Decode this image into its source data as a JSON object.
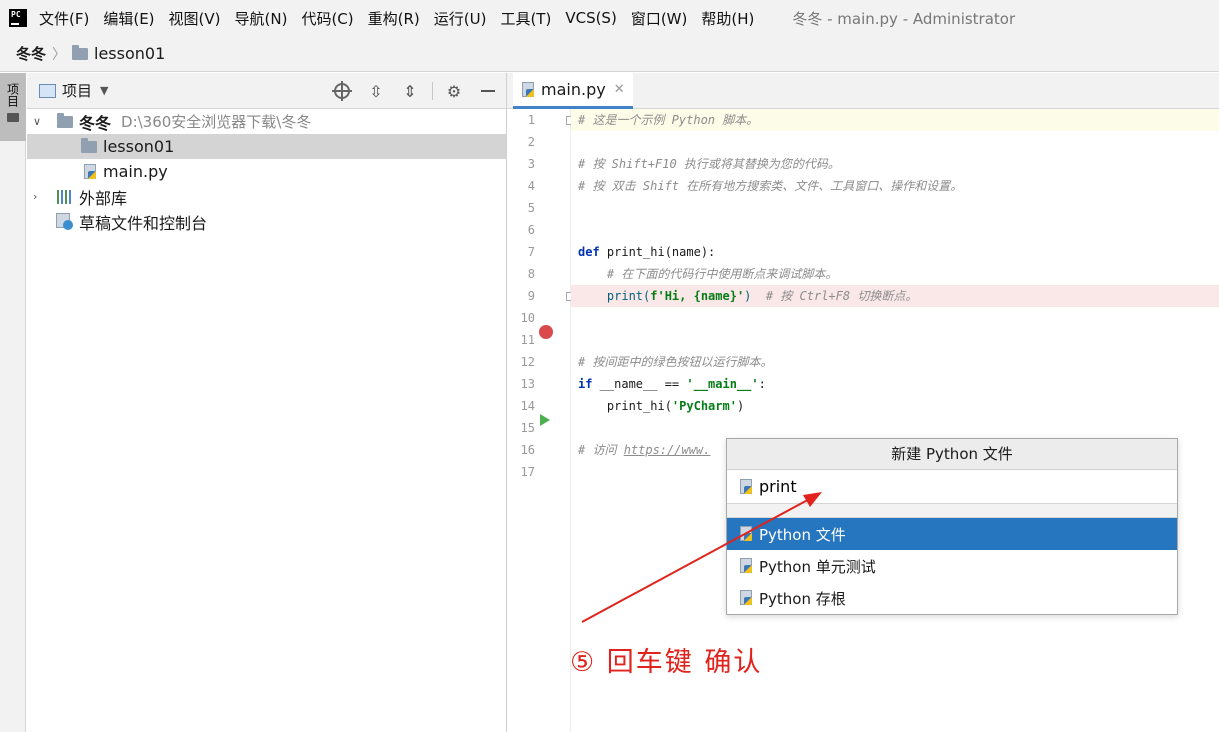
{
  "menubar": {
    "items": [
      "文件(F)",
      "编辑(E)",
      "视图(V)",
      "导航(N)",
      "代码(C)",
      "重构(R)",
      "运行(U)",
      "工具(T)",
      "VCS(S)",
      "窗口(W)",
      "帮助(H)"
    ],
    "window_title": "冬冬 - main.py - Administrator",
    "logo_text": "PC"
  },
  "breadcrumb": {
    "root": "冬冬",
    "child": "lesson01"
  },
  "toolstrip": {
    "project_label": "项目"
  },
  "project_panel": {
    "title": "项目",
    "tree": {
      "root_name": "冬冬",
      "root_path": "D:\\360安全浏览器下载\\冬冬",
      "folder": "lesson01",
      "file": "main.py",
      "external_libs": "外部库",
      "scratches": "草稿文件和控制台"
    }
  },
  "editor": {
    "tab_label": "main.py",
    "line_numbers": [
      "1",
      "2",
      "3",
      "4",
      "5",
      "6",
      "7",
      "8",
      "9",
      "10",
      "11",
      "12",
      "13",
      "14",
      "15",
      "16",
      "17"
    ],
    "code": {
      "l1": "# 这是一个示例 Python 脚本。",
      "l3": "# 按 Shift+F10 执行或将其替换为您的代码。",
      "l4": "# 按 双击 Shift 在所有地方搜索类、文件、工具窗口、操作和设置。",
      "l7_kw": "def",
      "l7_rest": " print_hi(name):",
      "l8": "    # 在下面的代码行中使用断点来调试脚本。",
      "l9_fn": "    print(",
      "l9_str": "f'Hi, {name}'",
      "l9_close": ")",
      "l9_cmt": "  # 按 Ctrl+F8 切换断点。",
      "l12": "# 按间距中的绿色按钮以运行脚本。",
      "l13_kw": "if",
      "l13_mid": " __name__ == ",
      "l13_str": "'__main__'",
      "l13_end": ":",
      "l14_a": "    print_hi(",
      "l14_str": "'PyCharm'",
      "l14_b": ")",
      "l16_cmt": "# 访问 ",
      "l16_link": "https://www."
    }
  },
  "popup": {
    "title": "新建 Python 文件",
    "input_value": "print",
    "items": [
      "Python 文件",
      "Python 单元测试",
      "Python 存根"
    ],
    "active_index": 0
  },
  "annotation": {
    "text": "⑤ 回车键 确认",
    "color": "#e0231c"
  },
  "colors": {
    "selection_blue": "#2675bf",
    "keyword": "#0033b3",
    "string": "#067d17",
    "comment": "#8c8c8c",
    "breakpoint": "#db4a4a"
  }
}
